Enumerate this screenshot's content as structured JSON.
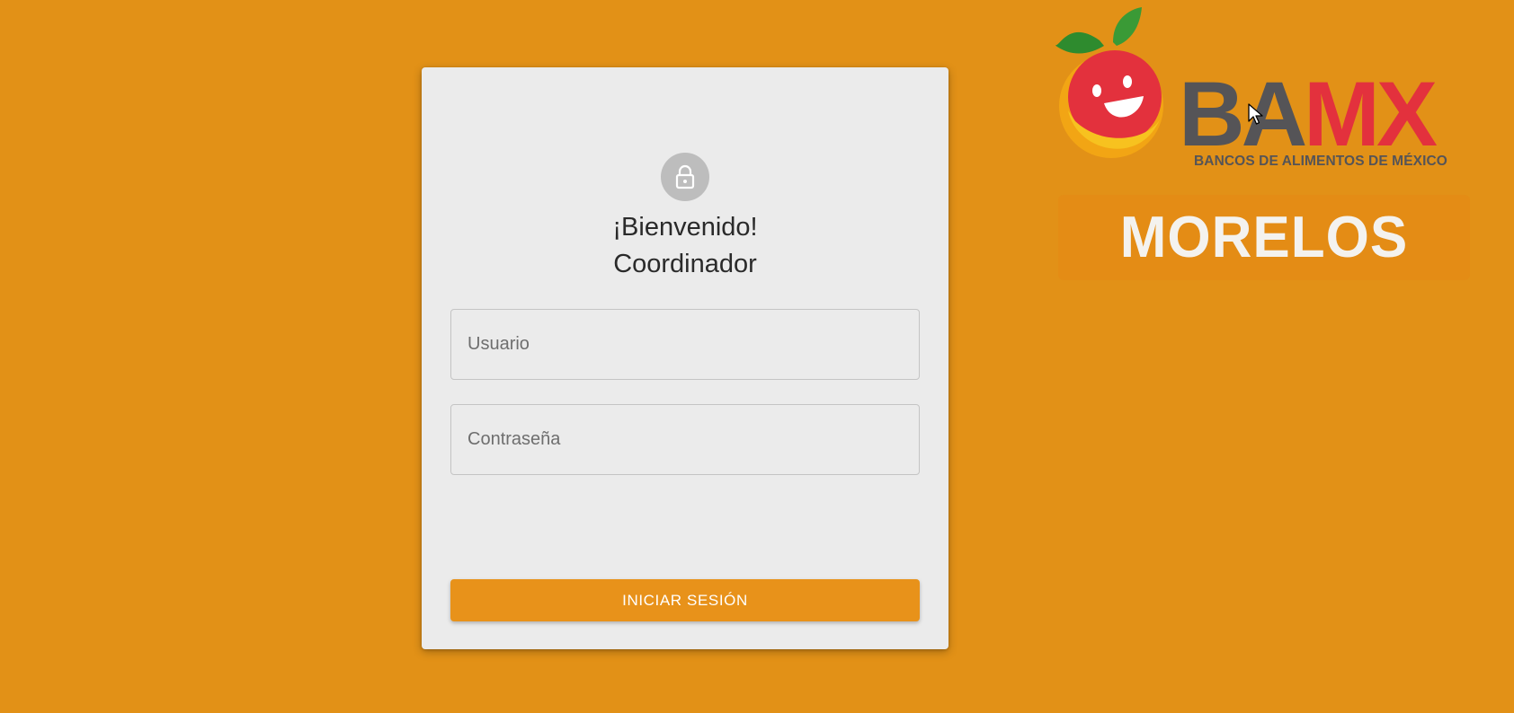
{
  "colors": {
    "background": "#e29117",
    "card": "#ebebeb",
    "accent": "#e8921a",
    "lock_avatar": "#bdbdbd",
    "brand_gray": "#555457",
    "brand_red": "#e3313d"
  },
  "login": {
    "icon": "lock-icon",
    "welcome_line1": "¡Bienvenido!",
    "welcome_line2": "Coordinador",
    "username_placeholder": "Usuario",
    "username_value": "",
    "password_placeholder": "Contraseña",
    "password_value": "",
    "submit_label": "INICIAR SESIÓN"
  },
  "brand": {
    "logo_icon": "apple-mascot-logo",
    "name_part1": "BA",
    "name_part2": "MX",
    "subtitle": "BANCOS DE ALIMENTOS DE MÉXICO",
    "region": "MORELOS"
  }
}
